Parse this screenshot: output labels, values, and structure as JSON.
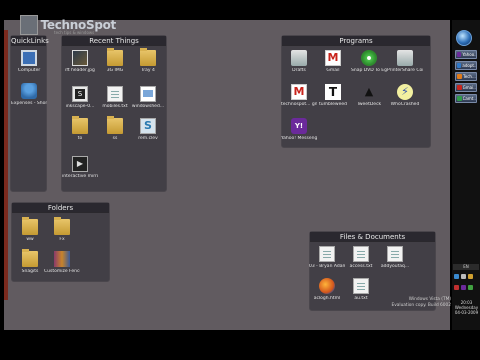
{
  "logo": {
    "text": "TechnoSpot",
    "sub": "tech tips & windows"
  },
  "fences": {
    "quicklinks": {
      "title": "QuickLinks",
      "items": [
        {
          "label": "Computer",
          "icon": "monitor-icon"
        },
        {
          "label": "Expenses - Shortcut",
          "icon": "people-icon"
        }
      ]
    },
    "recent": {
      "title": "Recent Things",
      "items": [
        {
          "label": "ift header.jpg",
          "icon": "image-icon"
        },
        {
          "label": "3G IMG",
          "icon": "folder-icon"
        },
        {
          "label": "Tray 4",
          "icon": "folder-icon"
        },
        {
          "label": "inkscape-0...",
          "icon": "inkscape-icon"
        },
        {
          "label": "mobiles.txt",
          "icon": "document-icon"
        },
        {
          "label": "windowshed...",
          "icon": "bitmap-icon"
        },
        {
          "label": "to",
          "icon": "folder-icon"
        },
        {
          "label": "ss",
          "icon": "folder-icon"
        },
        {
          "label": "rem.clev",
          "icon": "s-icon"
        },
        {
          "label": "interactive mirror.jpg",
          "icon": "video-icon"
        }
      ]
    },
    "programs": {
      "title": "Programs",
      "items": [
        {
          "label": "Drafts",
          "icon": "printer-icon"
        },
        {
          "label": "Gmail",
          "icon": "gmail-icon"
        },
        {
          "label": "Snap DVD To Egg Converter",
          "icon": "disc-icon"
        },
        {
          "label": "PrinterShare Console",
          "icon": "printer-icon"
        },
        {
          "label": "technospot... gmail",
          "icon": "gmail-icon"
        },
        {
          "label": "tumbleweed",
          "icon": "t-icon"
        },
        {
          "label": "TweetDeck",
          "icon": "bird-icon"
        },
        {
          "label": "WhoCrashed",
          "icon": "bolt-icon"
        },
        {
          "label": "Yahoo! Messenger",
          "icon": "yahoo-icon"
        }
      ]
    },
    "folders": {
      "title": "Folders",
      "items": [
        {
          "label": "ww",
          "icon": "folder-icon"
        },
        {
          "label": "Fx",
          "icon": "folder-icon"
        },
        {
          "label": "Snagits",
          "icon": "folder-icon"
        },
        {
          "label": "Customize Fences",
          "icon": "winrar-icon"
        }
      ]
    },
    "files": {
      "title": "Files & Documents",
      "items": [
        {
          "label": "03 - Bryan Adams - R...",
          "icon": "document-icon"
        },
        {
          "label": "access.txt",
          "icon": "document-icon"
        },
        {
          "label": "addyoufaq...",
          "icon": "document-icon"
        },
        {
          "label": "aclogh.html",
          "icon": "firefox-icon"
        },
        {
          "label": "au.txt",
          "icon": "document-icon"
        }
      ]
    }
  },
  "taskbar": {
    "items": [
      {
        "label": "Yahoo...",
        "color": "#6b2a9b"
      },
      {
        "label": "adopt...",
        "color": "#2f78c8"
      },
      {
        "label": "Tech...",
        "color": "#e07b1a"
      },
      {
        "label": "Gmai...",
        "color": "#c8241c"
      },
      {
        "label": "Camt...",
        "color": "#2f9b4a"
      }
    ],
    "language": "EN",
    "clock": {
      "time": "20:03",
      "day": "Wednesday",
      "date": "04-03-2009"
    }
  },
  "watermark": {
    "line1": "Windows Vista (TM)",
    "line2": "Evaluation copy. Build 6002"
  }
}
